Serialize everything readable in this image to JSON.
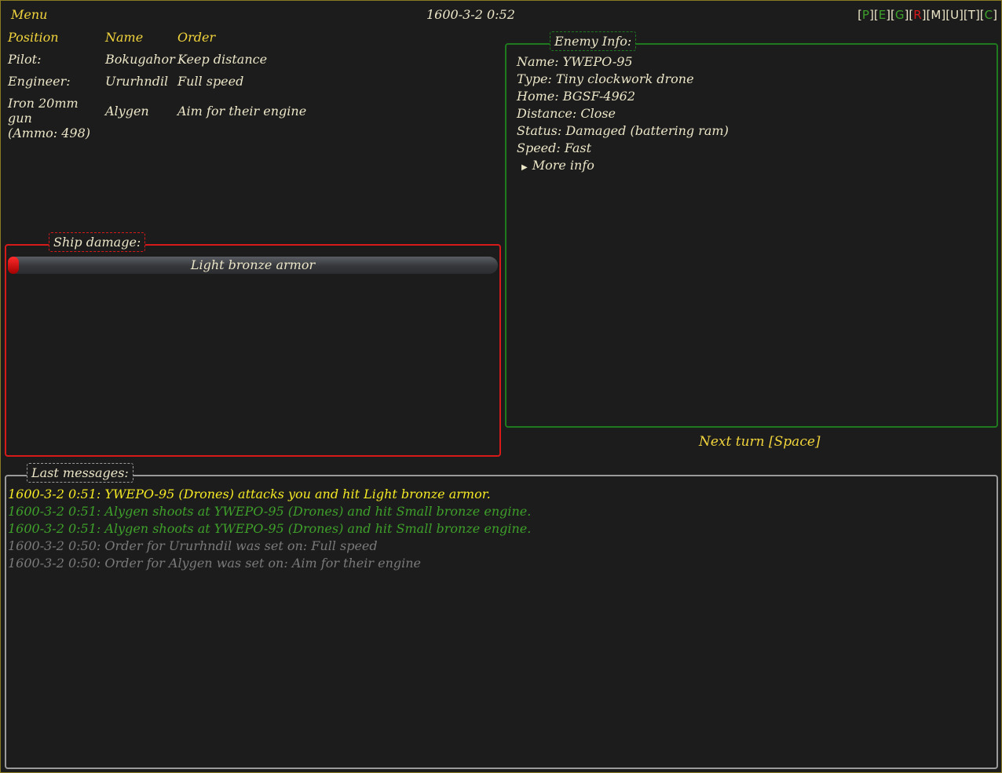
{
  "header": {
    "menu_label": "Menu",
    "datetime": "1600-3-2 0:52",
    "hotkeys": [
      {
        "key": "P",
        "color": "#3ea02a"
      },
      {
        "key": "E",
        "color": "#3ea02a"
      },
      {
        "key": "G",
        "color": "#3ea02a"
      },
      {
        "key": "R",
        "color": "#d61a1a"
      },
      {
        "key": "M",
        "color": "#ece6c8"
      },
      {
        "key": "U",
        "color": "#ece6c8"
      },
      {
        "key": "T",
        "color": "#ece6c8"
      },
      {
        "key": "C",
        "color": "#3ea02a"
      }
    ]
  },
  "crew": {
    "headers": {
      "position": "Position",
      "name": "Name",
      "order": "Order"
    },
    "rows": [
      {
        "position": "Pilot:",
        "name": "Bokugahor",
        "order": "Keep distance"
      },
      {
        "position": "Engineer:",
        "name": "Ururhndil",
        "order": "Full speed"
      },
      {
        "position_line1": "Iron 20mm gun",
        "position_line2": "(Ammo: 498)",
        "name": "Alygen",
        "order": "Aim for their engine"
      }
    ]
  },
  "ship_damage": {
    "title": "Ship damage:",
    "modules": [
      {
        "name": "Light bronze armor",
        "damage_fraction": 0.015
      }
    ]
  },
  "enemy_info": {
    "title": "Enemy Info:",
    "name": "Name: YWEPO-95",
    "type": "Type: Tiny clockwork drone",
    "home": "Home: BGSF-4962",
    "distance": "Distance: Close",
    "status": "Status: Damaged (battering ram)",
    "speed": "Speed: Fast",
    "more_info": "More info"
  },
  "next_turn_label": "Next turn [Space]",
  "messages": {
    "title": "Last messages:",
    "items": [
      {
        "text": "1600-3-2 0:51: YWEPO-95 (Drones) attacks you and hit Light bronze armor.",
        "color": "#f5ea24"
      },
      {
        "text": "1600-3-2 0:51: Alygen shoots at YWEPO-95 (Drones) and hit Small bronze engine.",
        "color": "#3ea02a"
      },
      {
        "text": "1600-3-2 0:51: Alygen shoots at YWEPO-95 (Drones) and hit Small bronze engine.",
        "color": "#3ea02a"
      },
      {
        "text": "1600-3-2 0:50: Order for Ururhndil was set on: Full speed",
        "color": "#7a7a7a"
      },
      {
        "text": "1600-3-2 0:50: Order for Alygen was set on: Aim for their engine",
        "color": "#7a7a7a"
      }
    ]
  }
}
